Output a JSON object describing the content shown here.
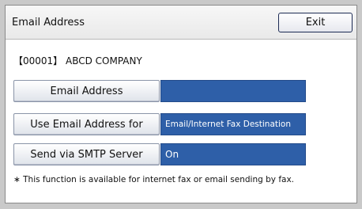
{
  "header": {
    "title": "Email Address",
    "exit_label": "Exit"
  },
  "company_label": "【00001】 ABCD COMPANY",
  "rows": [
    {
      "button_label": "Email Address",
      "value": ""
    },
    {
      "button_label": "Use Email Address for",
      "value": "Email/Internet Fax Destination"
    },
    {
      "button_label": "Send via SMTP Server",
      "value": "On"
    }
  ],
  "footnote": "∗ This function is available for internet fax or email sending by fax.",
  "colors": {
    "value_field_bg": "#2e5fa8",
    "exit_border": "#1d2b54"
  }
}
